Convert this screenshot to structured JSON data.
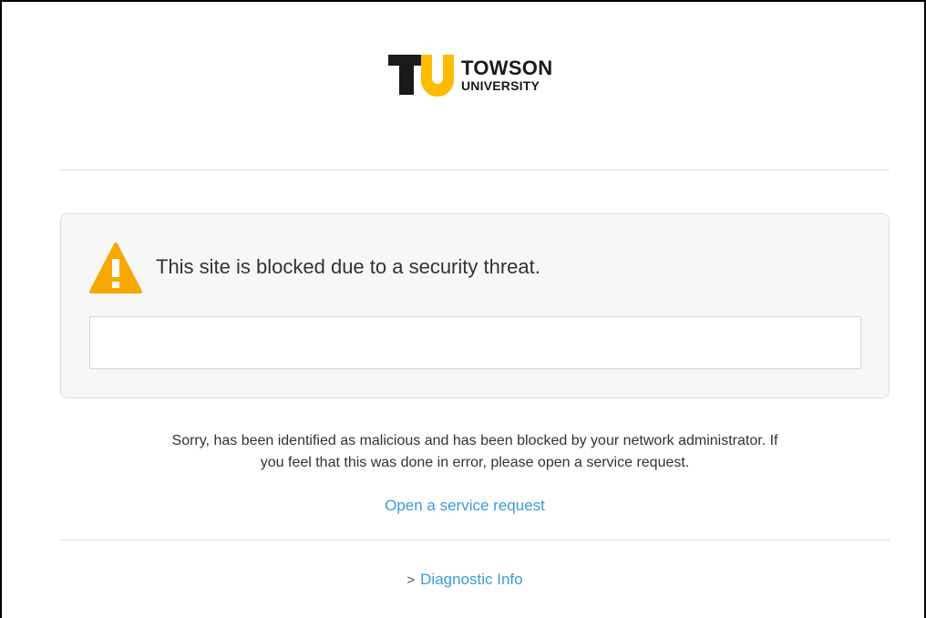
{
  "logo": {
    "mark": "TU",
    "line1": "TOWSON",
    "line2": "UNIVERSITY",
    "colors": {
      "dark": "#1a1a1a",
      "gold": "#ffbb00"
    }
  },
  "alert": {
    "icon": "warning-triangle-icon",
    "icon_color": "#f7a800",
    "title": "This site is blocked due to a security threat.",
    "url_value": ""
  },
  "message": {
    "line1": "Sorry, has been identified as malicious and has been blocked by your network administrator.  If",
    "line2": "you feel that this was done in error, please open a service request."
  },
  "links": {
    "service_request": "Open a service request",
    "diagnostic_chevron": ">",
    "diagnostic": "Diagnostic Info",
    "color": "#3a9bd8"
  }
}
